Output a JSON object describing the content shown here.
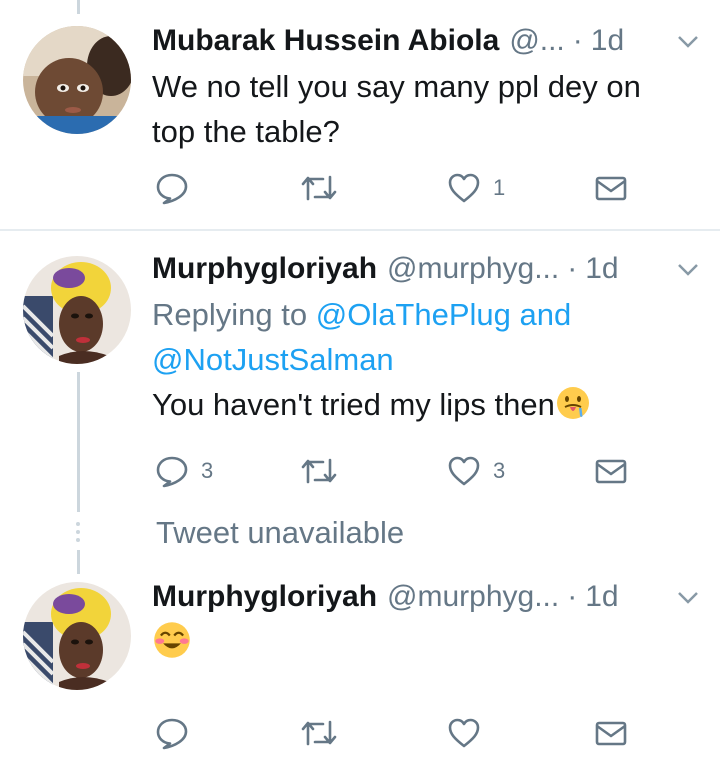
{
  "colors": {
    "text": "#14171a",
    "muted": "#657786",
    "link": "#1da1f2",
    "divider": "#e6ecf0",
    "thread_line": "#ccd6dd"
  },
  "tweets": [
    {
      "display_name": "Mubarak Hussein Abiola",
      "handle": "@...",
      "separator": "·",
      "time": "1d",
      "text": "We no tell you say many ppl dey on top the table?",
      "avatar_icon": "avatar-photo-child",
      "actions": {
        "reply_count": "",
        "retweet_count": "",
        "like_count": "1"
      }
    },
    {
      "display_name": "Murphygloriyah",
      "handle": "@murphyg...",
      "separator": "·",
      "time": "1d",
      "replying_prefix": "Replying to",
      "replying_mention_1": "@OlaThePlug",
      "replying_and": "and",
      "replying_mention_2": "@NotJustSalman",
      "text": "You haven't tried my lips then",
      "emoji": "drooling-face-emoji",
      "avatar_icon": "avatar-photo-woman-headwrap",
      "actions": {
        "reply_count": "3",
        "retweet_count": "",
        "like_count": "3"
      }
    },
    {
      "display_name": "Murphygloriyah",
      "handle": "@murphyg...",
      "separator": "·",
      "time": "1d",
      "text": "",
      "emoji": "smiling-face-emoji",
      "avatar_icon": "avatar-photo-woman-headwrap",
      "actions": {
        "reply_count": "",
        "retweet_count": "",
        "like_count": ""
      }
    }
  ],
  "unavailable_text": "Tweet unavailable"
}
